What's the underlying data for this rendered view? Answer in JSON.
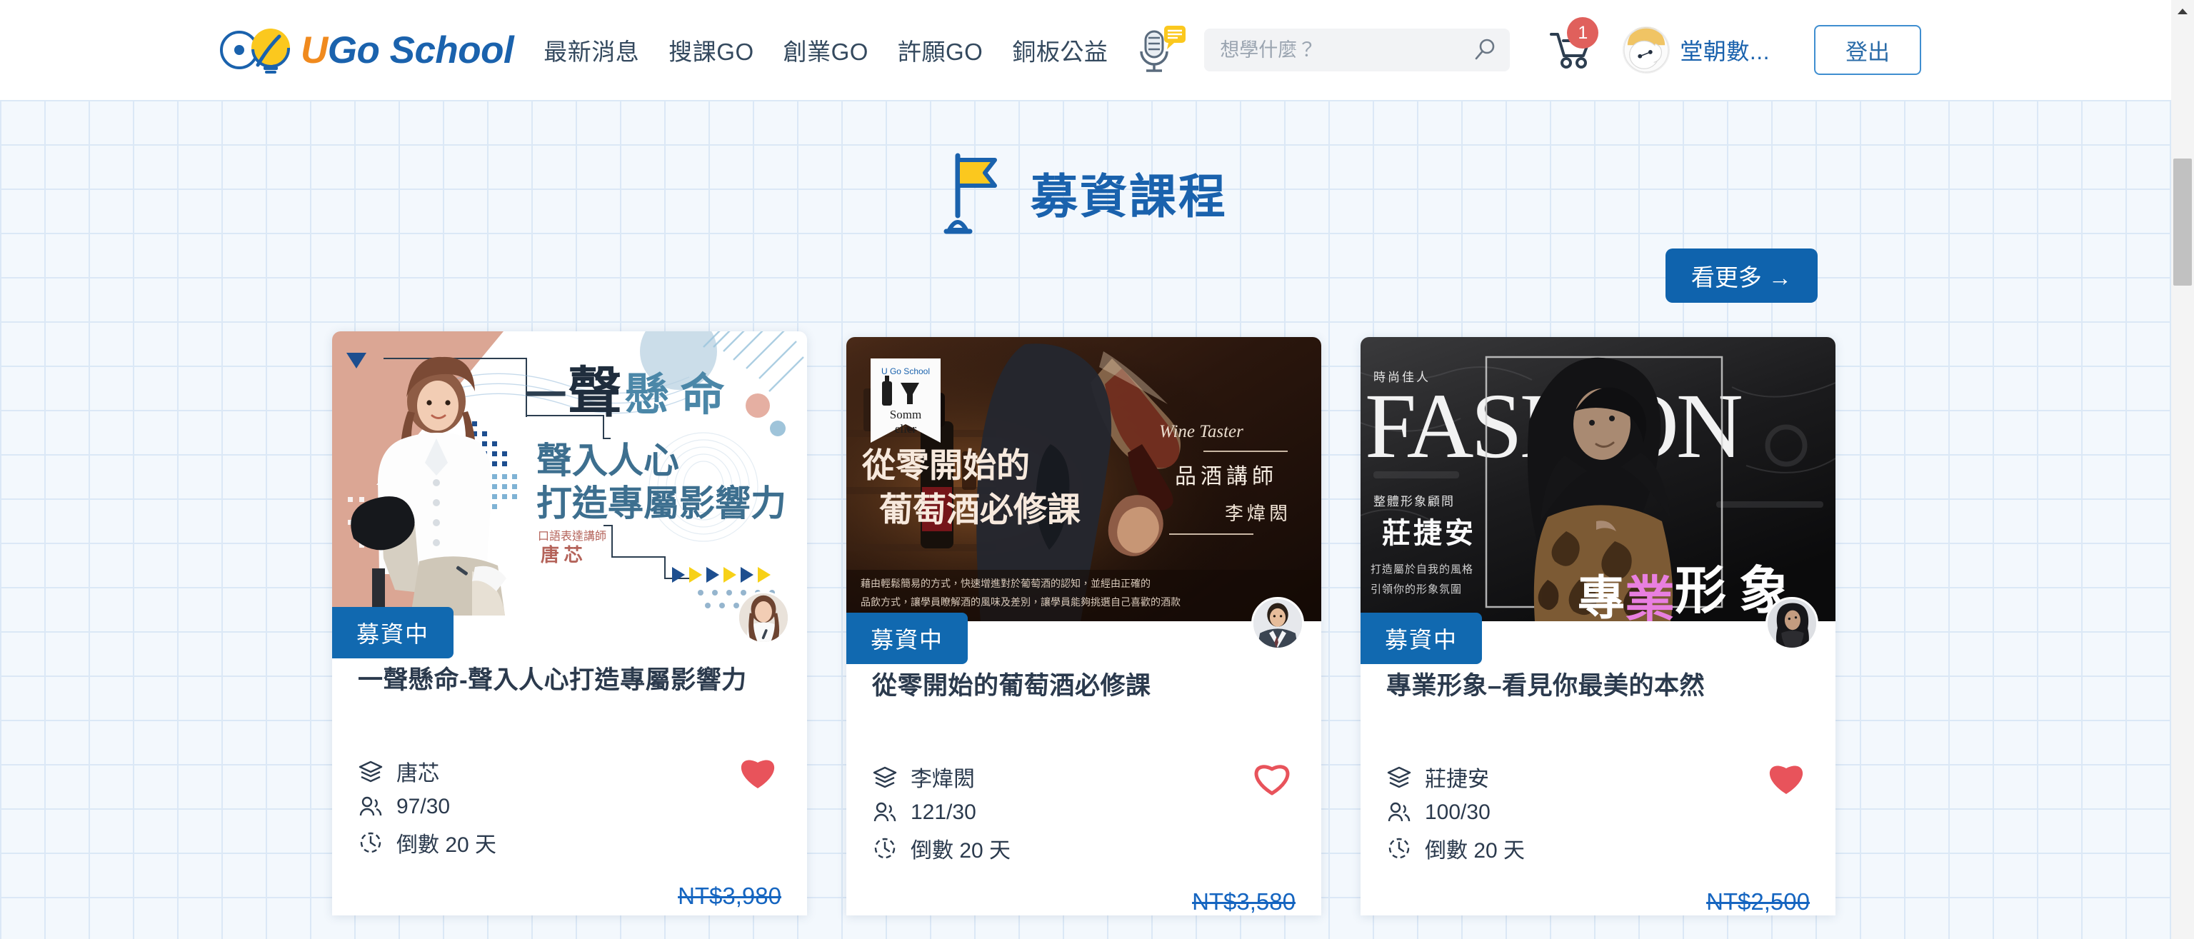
{
  "brand": {
    "logo_text_u": "U",
    "logo_text_rest": "Go School",
    "logo_icon": "infinity-lightbulb-logo"
  },
  "header": {
    "nav_items": [
      {
        "label": "最新消息",
        "name": "nav-item-news"
      },
      {
        "label": "搜課GO",
        "name": "nav-item-search-courses"
      },
      {
        "label": "創業GO",
        "name": "nav-item-startup"
      },
      {
        "label": "許願GO",
        "name": "nav-item-wish"
      },
      {
        "label": "銅板公益",
        "name": "nav-item-charity"
      }
    ],
    "mic_icon": "microphone-speech-bubble-icon",
    "search": {
      "placeholder": "想學什麼？",
      "value": "",
      "icon": "search-icon"
    },
    "cart": {
      "icon": "shopping-cart-icon",
      "badge_count": "1"
    },
    "user": {
      "name": "堂朝數...",
      "avatar": "user-avatar"
    },
    "logout_label": "登出"
  },
  "main": {
    "title": "募資課程",
    "title_icon": "yellow-flag-icon",
    "more_button_label": "看更多 →"
  },
  "colors": {
    "brand_blue": "#1a62ad",
    "brand_orange": "#f08a1e",
    "accent_yellow": "#fbc81e",
    "badge_blue": "#1169b0",
    "heart_red": "#e8535b",
    "price_blue": "#1565c0",
    "cart_badge_red": "#e0605c",
    "page_bg": "#f3f8fd",
    "grid_line": "#dbe8f6"
  },
  "courses": [
    {
      "badge": "募資中",
      "title": "一聲懸命-聲入人心打造專屬影響力",
      "instructor": "唐芯",
      "enrolled": "97/30",
      "countdown": "倒數 20 天",
      "price": "NT$3,980",
      "liked": true,
      "thumb": {
        "headline_1": "一",
        "headline_2": "聲",
        "headline_3": "懸 命",
        "sub_1": "聲入人心",
        "sub_2": "打造專屬影響力",
        "role": "口語表達講師",
        "name": "唐 芯"
      }
    },
    {
      "badge": "募資中",
      "title": "從零開始的葡萄酒必修課",
      "instructor": "李煒閎",
      "enrolled": "121/30",
      "countdown": "倒數 20 天",
      "price": "NT$3,580",
      "liked": false,
      "thumb": {
        "logo_label": "U Go School",
        "logo_sub_1": "Somm",
        "logo_sub_2": "elier",
        "headline_1": "從零開始的",
        "headline_2": "葡萄酒必修課",
        "eyebrow": "Wine Taster",
        "role": "品酒講師",
        "name": "李煒閎",
        "caption_1": "藉由輕鬆簡易的方式，快速增進對於葡萄酒的認知，並經由正確的",
        "caption_2": "品飲方式，讓學員瞭解酒的風味及差別，讓學員能夠挑選自己喜歡的酒款"
      }
    },
    {
      "badge": "募資中",
      "title": "專業形象–看見你最美的本然",
      "instructor": "莊捷安",
      "enrolled": "100/30",
      "countdown": "倒數 20 天",
      "price": "NT$2,500",
      "liked": true,
      "thumb": {
        "eyebrow": "時尚佳人",
        "headline": "FASHION",
        "role": "整體形象顧問",
        "name": "莊捷安",
        "caption_1": "打造屬於自我的風格",
        "caption_2": "引領你的形象氛圍",
        "overlay_1": "專",
        "overlay_2": "業",
        "overlay_3": "形 象"
      }
    }
  ],
  "meta_icon_names": {
    "instructor": "layers-icon",
    "enrolled": "people-icon",
    "countdown": "clock-countdown-icon",
    "like": "heart-icon"
  },
  "scrollbar": {
    "up_arrow": "scroll-up-arrow"
  }
}
